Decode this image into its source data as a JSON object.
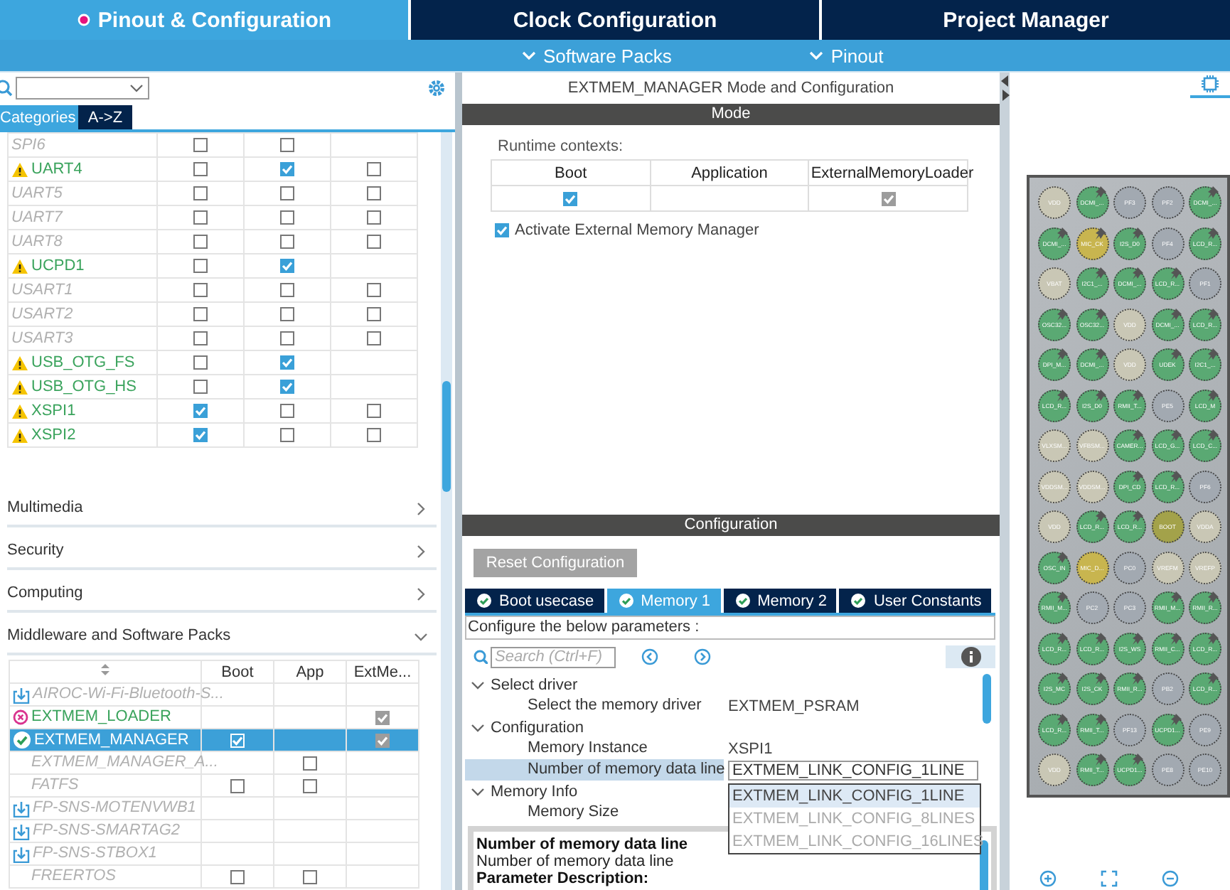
{
  "top_tabs": [
    {
      "label": "Pinout & Configuration",
      "selected": true
    },
    {
      "label": "Clock Configuration",
      "selected": false
    },
    {
      "label": "Project Manager",
      "selected": false
    }
  ],
  "menu_bar": [
    "Software Packs",
    "Pinout"
  ],
  "left": {
    "filter_tabs": [
      {
        "label": "Categories",
        "selected": true
      },
      {
        "label": "A->Z",
        "selected": false
      }
    ],
    "peripherals": [
      {
        "name": "SPI6",
        "kind": "plain",
        "active": false,
        "checks": [
          {
            "kind": "checkbox",
            "checked": false
          },
          {
            "kind": "checkbox",
            "checked": false
          },
          {
            "kind": "empty"
          }
        ]
      },
      {
        "name": "UART4",
        "kind": "warning",
        "active": true,
        "checks": [
          {
            "kind": "checkbox",
            "checked": false
          },
          {
            "kind": "checkbox",
            "checked": true
          },
          {
            "kind": "checkbox",
            "checked": false
          }
        ]
      },
      {
        "name": "UART5",
        "kind": "plain",
        "active": false,
        "checks": [
          {
            "kind": "checkbox",
            "checked": false
          },
          {
            "kind": "checkbox",
            "checked": false
          },
          {
            "kind": "checkbox",
            "checked": false
          }
        ]
      },
      {
        "name": "UART7",
        "kind": "plain",
        "active": false,
        "checks": [
          {
            "kind": "checkbox",
            "checked": false
          },
          {
            "kind": "checkbox",
            "checked": false
          },
          {
            "kind": "checkbox",
            "checked": false
          }
        ]
      },
      {
        "name": "UART8",
        "kind": "plain",
        "active": false,
        "checks": [
          {
            "kind": "checkbox",
            "checked": false
          },
          {
            "kind": "checkbox",
            "checked": false
          },
          {
            "kind": "checkbox",
            "checked": false
          }
        ]
      },
      {
        "name": "UCPD1",
        "kind": "warning",
        "active": true,
        "checks": [
          {
            "kind": "checkbox",
            "checked": false
          },
          {
            "kind": "checkbox",
            "checked": true
          },
          {
            "kind": "empty"
          }
        ]
      },
      {
        "name": "USART1",
        "kind": "plain",
        "active": false,
        "checks": [
          {
            "kind": "checkbox",
            "checked": false
          },
          {
            "kind": "checkbox",
            "checked": false
          },
          {
            "kind": "checkbox",
            "checked": false
          }
        ]
      },
      {
        "name": "USART2",
        "kind": "plain",
        "active": false,
        "checks": [
          {
            "kind": "checkbox",
            "checked": false
          },
          {
            "kind": "checkbox",
            "checked": false
          },
          {
            "kind": "checkbox",
            "checked": false
          }
        ]
      },
      {
        "name": "USART3",
        "kind": "plain",
        "active": false,
        "checks": [
          {
            "kind": "checkbox",
            "checked": false
          },
          {
            "kind": "checkbox",
            "checked": false
          },
          {
            "kind": "checkbox",
            "checked": false
          }
        ]
      },
      {
        "name": "USB_OTG_FS",
        "kind": "warning",
        "active": true,
        "checks": [
          {
            "kind": "checkbox",
            "checked": false
          },
          {
            "kind": "checkbox",
            "checked": true
          },
          {
            "kind": "empty"
          }
        ]
      },
      {
        "name": "USB_OTG_HS",
        "kind": "warning",
        "active": true,
        "checks": [
          {
            "kind": "checkbox",
            "checked": false
          },
          {
            "kind": "checkbox",
            "checked": true
          },
          {
            "kind": "empty"
          }
        ]
      },
      {
        "name": "XSPI1",
        "kind": "warning",
        "active": true,
        "checks": [
          {
            "kind": "checkbox",
            "checked": true
          },
          {
            "kind": "checkbox",
            "checked": false
          },
          {
            "kind": "checkbox",
            "checked": false
          }
        ]
      },
      {
        "name": "XSPI2",
        "kind": "warning",
        "active": true,
        "checks": [
          {
            "kind": "checkbox",
            "checked": true
          },
          {
            "kind": "checkbox",
            "checked": false
          },
          {
            "kind": "checkbox",
            "checked": false
          }
        ]
      }
    ],
    "categories": [
      {
        "label": "Multimedia",
        "expanded": false
      },
      {
        "label": "Security",
        "expanded": false
      },
      {
        "label": "Computing",
        "expanded": false
      },
      {
        "label": "Middleware and Software Packs",
        "expanded": true
      }
    ],
    "packs": {
      "columns": [
        "Boot",
        "App",
        "ExtMe..."
      ],
      "rows": [
        {
          "name": "AIROC-Wi-Fi-Bluetooth-S...",
          "kind": "download",
          "active": false,
          "selected": false,
          "checks": [
            {
              "kind": "empty"
            },
            {
              "kind": "empty"
            },
            {
              "kind": "empty"
            }
          ]
        },
        {
          "name": "EXTMEM_LOADER",
          "kind": "error",
          "active": true,
          "selected": false,
          "checks": [
            {
              "kind": "empty"
            },
            {
              "kind": "empty"
            },
            {
              "kind": "checkbox",
              "checked": true,
              "disabled": true
            }
          ]
        },
        {
          "name": "EXTMEM_MANAGER",
          "kind": "ok",
          "active": true,
          "selected": true,
          "checks": [
            {
              "kind": "checkbox",
              "checked": true,
              "disabled": false
            },
            {
              "kind": "empty"
            },
            {
              "kind": "checkbox",
              "checked": true,
              "disabled": true
            }
          ]
        },
        {
          "name": "EXTMEM_MANAGER_A...",
          "kind": "plain",
          "active": false,
          "selected": false,
          "checks": [
            {
              "kind": "empty"
            },
            {
              "kind": "checkbox",
              "checked": false,
              "disabled": false
            },
            {
              "kind": "empty"
            }
          ]
        },
        {
          "name": "FATFS",
          "kind": "plain",
          "active": false,
          "selected": false,
          "checks": [
            {
              "kind": "checkbox",
              "checked": false,
              "disabled": false
            },
            {
              "kind": "checkbox",
              "checked": false,
              "disabled": false
            },
            {
              "kind": "empty"
            }
          ]
        },
        {
          "name": "FP-SNS-MOTENVWB1",
          "kind": "download",
          "active": false,
          "selected": false,
          "checks": [
            {
              "kind": "empty"
            },
            {
              "kind": "empty"
            },
            {
              "kind": "empty"
            }
          ]
        },
        {
          "name": "FP-SNS-SMARTAG2",
          "kind": "download",
          "active": false,
          "selected": false,
          "checks": [
            {
              "kind": "empty"
            },
            {
              "kind": "empty"
            },
            {
              "kind": "empty"
            }
          ]
        },
        {
          "name": "FP-SNS-STBOX1",
          "kind": "download",
          "active": false,
          "selected": false,
          "checks": [
            {
              "kind": "empty"
            },
            {
              "kind": "empty"
            },
            {
              "kind": "empty"
            }
          ]
        },
        {
          "name": "FREERTOS",
          "kind": "plain",
          "active": false,
          "selected": false,
          "checks": [
            {
              "kind": "checkbox",
              "checked": false,
              "disabled": false
            },
            {
              "kind": "checkbox",
              "checked": false,
              "disabled": false
            },
            {
              "kind": "empty"
            }
          ]
        }
      ]
    }
  },
  "mode_panel": {
    "title": "EXTMEM_MANAGER Mode and Configuration",
    "header": "Mode",
    "contexts_label": "Runtime contexts:",
    "contexts": [
      {
        "label": "Boot",
        "check": {
          "checked": true,
          "disabled": false
        }
      },
      {
        "label": "Application"
      },
      {
        "label": "ExternalMemoryLoader",
        "check": {
          "checked": true,
          "disabled": true
        }
      }
    ],
    "activate": {
      "label": "Activate External Memory Manager",
      "checked": true
    }
  },
  "config_panel": {
    "header": "Configuration",
    "reset_button": "Reset Configuration",
    "tabs": [
      {
        "label": "Boot usecase",
        "selected": false
      },
      {
        "label": "Memory 1",
        "selected": true
      },
      {
        "label": "Memory 2",
        "selected": false
      },
      {
        "label": "User Constants",
        "selected": false
      }
    ],
    "hint": "Configure the below parameters :",
    "search_placeholder": "Search (Ctrl+F)",
    "tree": [
      {
        "label": "Select driver",
        "expanded": true,
        "children": [
          {
            "label": "Select the memory driver",
            "kind": "text",
            "value": "EXTMEM_PSRAM",
            "selected": false
          }
        ]
      },
      {
        "label": "Configuration",
        "expanded": true,
        "children": [
          {
            "label": "Memory Instance",
            "kind": "text",
            "value": "XSPI1",
            "selected": false
          },
          {
            "label": "Number of memory data line",
            "kind": "dropdown",
            "value": "EXTMEM_LINK_CONFIG_1LINE",
            "selected": true,
            "options": [
              {
                "label": "EXTMEM_LINK_CONFIG_1LINE",
                "selected": true
              },
              {
                "label": "EXTMEM_LINK_CONFIG_8LINES",
                "selected": false
              },
              {
                "label": "EXTMEM_LINK_CONFIG_16LINES",
                "selected": false
              }
            ]
          }
        ]
      },
      {
        "label": "Memory Info",
        "expanded": true,
        "children": [
          {
            "label": "Memory Size",
            "kind": "text",
            "selected": false
          }
        ]
      }
    ],
    "description": {
      "title": "Number of memory data line",
      "text": "Number of memory data line",
      "heading": "Parameter Description:"
    }
  },
  "pinout": {
    "pins": [
      [
        {
          "label": "VDD",
          "color": "#c9c7b5",
          "pinned": false
        },
        {
          "label": "DCMI_...",
          "color": "#5aa973",
          "pinned": true
        },
        {
          "label": "PF3",
          "color": "#a2a9b1",
          "pinned": false
        },
        {
          "label": "PF2",
          "color": "#a2a9b1",
          "pinned": false
        },
        {
          "label": "DCMI_...",
          "color": "#5aa973",
          "pinned": true
        }
      ],
      [
        {
          "label": "DCMI_...",
          "color": "#5aa973",
          "pinned": true
        },
        {
          "label": "MIC_CK",
          "color": "#c8b54f",
          "pinned": true
        },
        {
          "label": "I2S_D0",
          "color": "#5aa973",
          "pinned": true
        },
        {
          "label": "PF4",
          "color": "#a2a9b1",
          "pinned": false
        },
        {
          "label": "LCD_R...",
          "color": "#5aa973",
          "pinned": true
        }
      ],
      [
        {
          "label": "VBAT",
          "color": "#c9c7b5",
          "pinned": false
        },
        {
          "label": "I2C1_...",
          "color": "#5aa973",
          "pinned": true
        },
        {
          "label": "DCMI_...",
          "color": "#5aa973",
          "pinned": true
        },
        {
          "label": "LCD_R...",
          "color": "#5aa973",
          "pinned": true
        },
        {
          "label": "PF1",
          "color": "#a2a9b1",
          "pinned": false
        }
      ],
      [
        {
          "label": "OSC32...",
          "color": "#5aa973",
          "pinned": true
        },
        {
          "label": "OSC32...",
          "color": "#5aa973",
          "pinned": true
        },
        {
          "label": "VDD",
          "color": "#c9c7b5",
          "pinned": false
        },
        {
          "label": "DCMI_...",
          "color": "#5aa973",
          "pinned": true
        },
        {
          "label": "LCD_R...",
          "color": "#5aa973",
          "pinned": true
        }
      ],
      [
        {
          "label": "DPI_M...",
          "color": "#5aa973",
          "pinned": true
        },
        {
          "label": "DCMI_...",
          "color": "#5aa973",
          "pinned": true
        },
        {
          "label": "VDD",
          "color": "#c9c7b5",
          "pinned": false
        },
        {
          "label": "UDEK",
          "color": "#5aa973",
          "pinned": true
        },
        {
          "label": "I2C1_...",
          "color": "#5aa973",
          "pinned": true
        }
      ],
      [
        {
          "label": "LCD_R...",
          "color": "#5aa973",
          "pinned": true
        },
        {
          "label": "I2S_D0",
          "color": "#5aa973",
          "pinned": true
        },
        {
          "label": "RMII_T...",
          "color": "#5aa973",
          "pinned": true
        },
        {
          "label": "PE5",
          "color": "#a2a9b1",
          "pinned": false
        },
        {
          "label": "LCD_M",
          "color": "#5aa973",
          "pinned": true
        }
      ],
      [
        {
          "label": "VLXSM...",
          "color": "#c9c7b5",
          "pinned": false
        },
        {
          "label": "VFBSM...",
          "color": "#c9c7b5",
          "pinned": false
        },
        {
          "label": "CAMER...",
          "color": "#5aa973",
          "pinned": true
        },
        {
          "label": "LCD_G...",
          "color": "#5aa973",
          "pinned": true
        },
        {
          "label": "LCD_C...",
          "color": "#5aa973",
          "pinned": true
        }
      ],
      [
        {
          "label": "VDDSM...",
          "color": "#c9c7b5",
          "pinned": false
        },
        {
          "label": "VDDSM...",
          "color": "#c9c7b5",
          "pinned": false
        },
        {
          "label": "DPI_CD",
          "color": "#5aa973",
          "pinned": true
        },
        {
          "label": "LCD_R...",
          "color": "#5aa973",
          "pinned": true
        },
        {
          "label": "PF6",
          "color": "#a2a9b1",
          "pinned": false
        }
      ],
      [
        {
          "label": "VDD",
          "color": "#c9c7b5",
          "pinned": false
        },
        {
          "label": "LCD_R...",
          "color": "#5aa973",
          "pinned": true
        },
        {
          "label": "LCD_R...",
          "color": "#5aa973",
          "pinned": true
        },
        {
          "label": "BOOT",
          "color": "#a3a24a",
          "pinned": false
        },
        {
          "label": "VDDA",
          "color": "#c9c7b5",
          "pinned": false
        }
      ],
      [
        {
          "label": "OSC_IN",
          "color": "#5aa973",
          "pinned": true
        },
        {
          "label": "MIC_D...",
          "color": "#c8b54f",
          "pinned": false
        },
        {
          "label": "PC0",
          "color": "#a2a9b1",
          "pinned": false
        },
        {
          "label": "VREFM",
          "color": "#c9c7b5",
          "pinned": false
        },
        {
          "label": "VREFP",
          "color": "#c9c7b5",
          "pinned": false
        }
      ],
      [
        {
          "label": "RMII_M...",
          "color": "#5aa973",
          "pinned": true
        },
        {
          "label": "PC2",
          "color": "#a2a9b1",
          "pinned": false
        },
        {
          "label": "PC3",
          "color": "#a2a9b1",
          "pinned": false
        },
        {
          "label": "RMII_M...",
          "color": "#5aa973",
          "pinned": true
        },
        {
          "label": "RMII_R...",
          "color": "#5aa973",
          "pinned": true
        }
      ],
      [
        {
          "label": "LCD_R...",
          "color": "#5aa973",
          "pinned": true
        },
        {
          "label": "LCD_R...",
          "color": "#5aa973",
          "pinned": true
        },
        {
          "label": "I2S_WS",
          "color": "#5aa973",
          "pinned": true
        },
        {
          "label": "RMII_C...",
          "color": "#5aa973",
          "pinned": true
        },
        {
          "label": "LCD_R...",
          "color": "#5aa973",
          "pinned": true
        }
      ],
      [
        {
          "label": "I2S_MC",
          "color": "#5aa973",
          "pinned": true
        },
        {
          "label": "I2S_CK",
          "color": "#5aa973",
          "pinned": true
        },
        {
          "label": "RMII_R...",
          "color": "#5aa973",
          "pinned": true
        },
        {
          "label": "PB2",
          "color": "#a2a9b1",
          "pinned": false
        },
        {
          "label": "LCD_R...",
          "color": "#5aa973",
          "pinned": true
        }
      ],
      [
        {
          "label": "LCD_R...",
          "color": "#5aa973",
          "pinned": true
        },
        {
          "label": "RMII_T...",
          "color": "#5aa973",
          "pinned": true
        },
        {
          "label": "PF13",
          "color": "#a2a9b1",
          "pinned": false
        },
        {
          "label": "UCPD1...",
          "color": "#5aa973",
          "pinned": true
        },
        {
          "label": "PE9",
          "color": "#a2a9b1",
          "pinned": false
        }
      ],
      [
        {
          "label": "VDD",
          "color": "#c9c7b5",
          "pinned": false
        },
        {
          "label": "RMII_T...",
          "color": "#5aa973",
          "pinned": true
        },
        {
          "label": "UCPD1...",
          "color": "#5aa973",
          "pinned": true
        },
        {
          "label": "PE8",
          "color": "#a2a9b1",
          "pinned": false
        },
        {
          "label": "PE10",
          "color": "#a2a9b1",
          "pinned": false
        }
      ]
    ]
  }
}
